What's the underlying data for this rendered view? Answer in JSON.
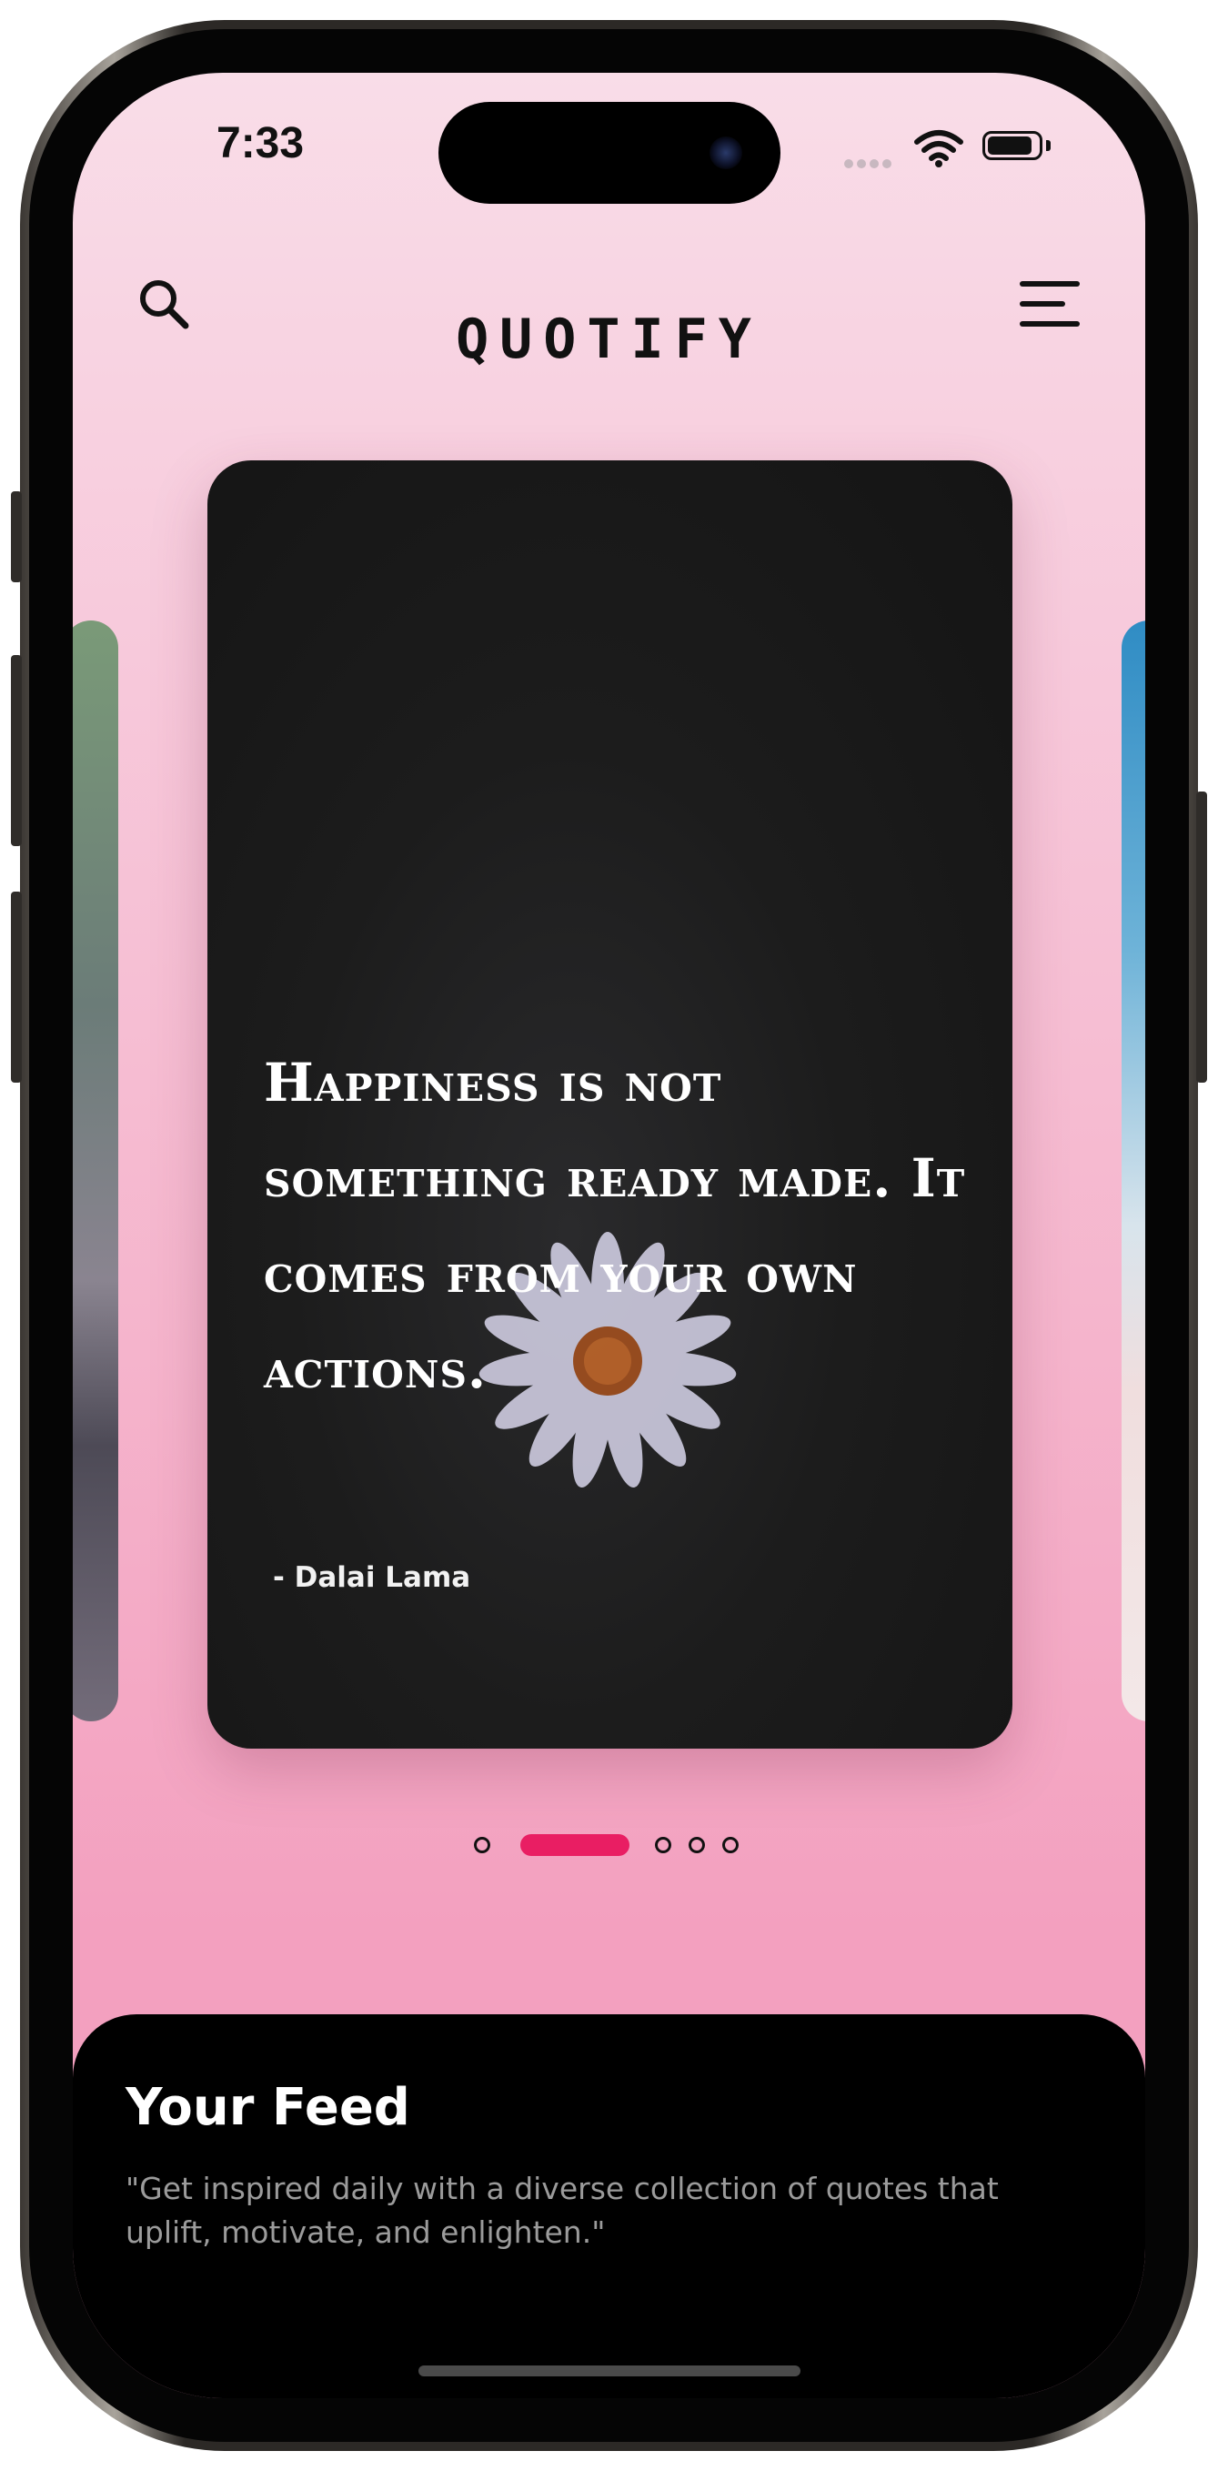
{
  "status_bar": {
    "time": "7:33",
    "icons": [
      "cellular-signal-icon",
      "wifi-icon",
      "battery-icon"
    ]
  },
  "header": {
    "logo": "QUOTIFY",
    "left_icon": "search-icon",
    "right_icon": "menu-icon"
  },
  "carousel": {
    "active_index": 1,
    "page_count": 5,
    "active_card": {
      "quote": "Happiness is not something ready made. It comes from your own actions.",
      "author": "- Dalai Lama",
      "background": "daisy-flower-photo"
    },
    "accent_color": "#e91e63"
  },
  "feed": {
    "title": "Your Feed",
    "description": "\"Get inspired daily with a diverse collection of quotes that uplift, motivate, and enlighten.\""
  }
}
